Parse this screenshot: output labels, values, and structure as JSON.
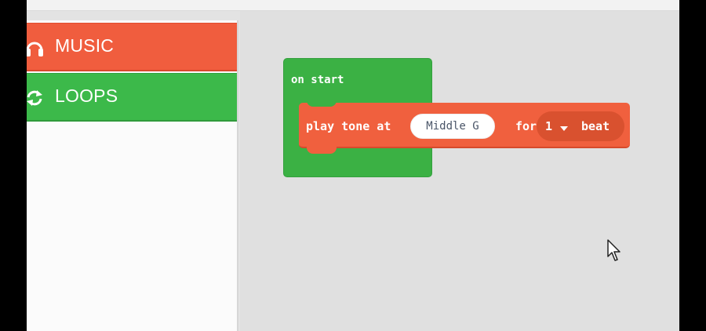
{
  "toolbox": {
    "categories": [
      {
        "label": "MUSIC",
        "icon": "headphones-icon",
        "color": "#f05d3e"
      },
      {
        "label": "LOOPS",
        "icon": "refresh-icon",
        "color": "#3cb94a"
      }
    ]
  },
  "workspace": {
    "event_block": {
      "label": "on start",
      "color": "#3bb144"
    },
    "tone_block": {
      "prefix": "play tone at",
      "note": "Middle G",
      "connector": "for",
      "beat_value": "1",
      "beat_unit": "beat",
      "color": "#f0603e"
    }
  }
}
